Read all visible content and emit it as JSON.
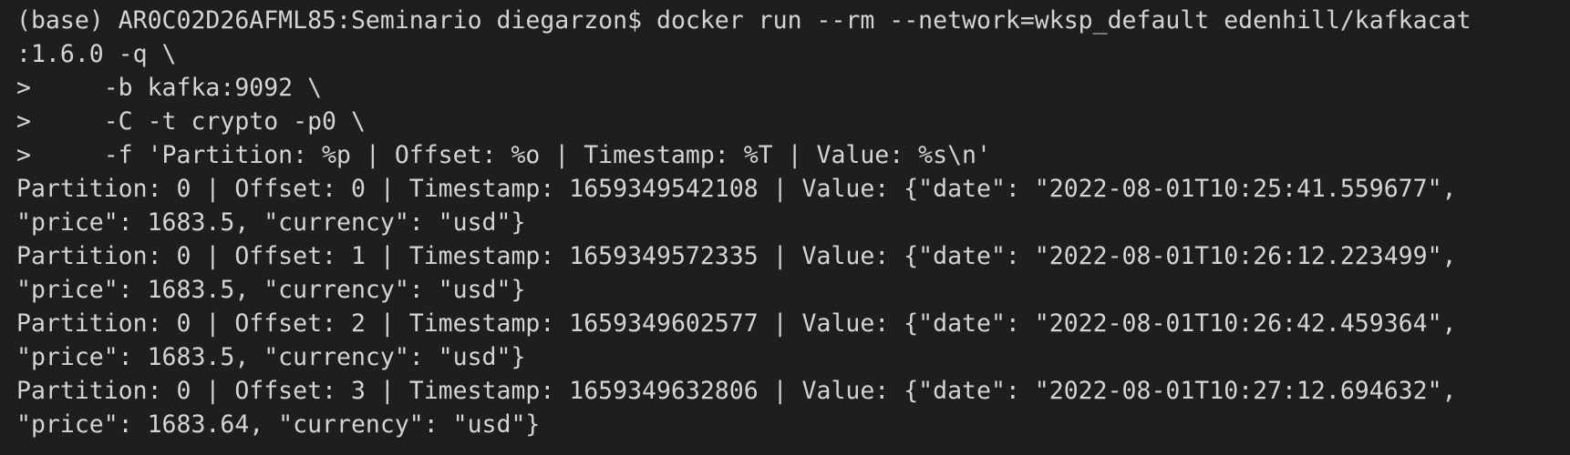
{
  "terminal": {
    "lines": [
      "(base) AR0C02D26AFML85:Seminario diegarzon$ docker run --rm --network=wksp_default edenhill/kafkacat",
      ":1.6.0 -q \\",
      ">     -b kafka:9092 \\",
      ">     -C -t crypto -p0 \\",
      ">     -f 'Partition: %p | Offset: %o | Timestamp: %T | Value: %s\\n'",
      "Partition: 0 | Offset: 0 | Timestamp: 1659349542108 | Value: {\"date\": \"2022-08-01T10:25:41.559677\",",
      "\"price\": 1683.5, \"currency\": \"usd\"}",
      "Partition: 0 | Offset: 1 | Timestamp: 1659349572335 | Value: {\"date\": \"2022-08-01T10:26:12.223499\",",
      "\"price\": 1683.5, \"currency\": \"usd\"}",
      "Partition: 0 | Offset: 2 | Timestamp: 1659349602577 | Value: {\"date\": \"2022-08-01T10:26:42.459364\",",
      "\"price\": 1683.5, \"currency\": \"usd\"}",
      "Partition: 0 | Offset: 3 | Timestamp: 1659349632806 | Value: {\"date\": \"2022-08-01T10:27:12.694632\",",
      "\"price\": 1683.64, \"currency\": \"usd\"}"
    ]
  }
}
